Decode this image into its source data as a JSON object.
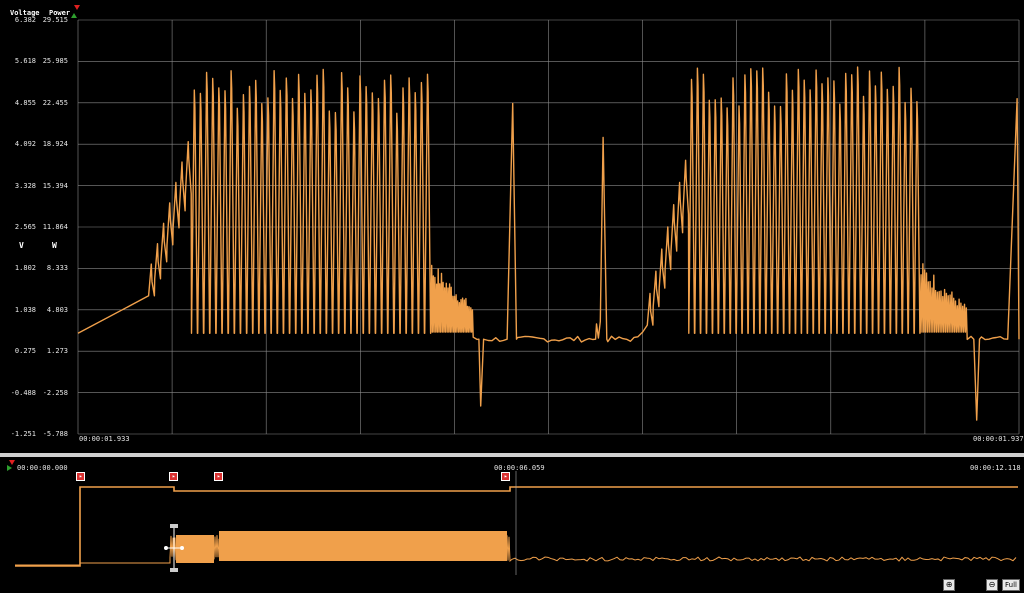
{
  "chart_data": {
    "type": "line",
    "left_axis_title": "Voltage",
    "right_axis_title": "Power",
    "left_unit": "V",
    "right_unit": "W",
    "voltage_ticks": [
      "6.382",
      "5.618",
      "4.855",
      "4.092",
      "3.328",
      "2.565",
      "1.802",
      "1.038",
      "0.275",
      "-0.488",
      "-1.251"
    ],
    "power_ticks": [
      "29.515",
      "25.985",
      "22.455",
      "18.924",
      "15.394",
      "11.864",
      "8.333",
      "4.803",
      "1.273",
      "-2.258",
      "-5.788"
    ],
    "ylim": [
      -5.788,
      29.515
    ],
    "x_start": "00:00:01.933",
    "x_end": "00:00:01.937",
    "overview_start": "00:00:00.000",
    "overview_mid": "00:00:06.059",
    "overview_end": "00:00:12.118",
    "grid": true,
    "series": [
      {
        "color": "#f0a04b",
        "bursts": [
          {
            "t_start": 0.075,
            "t_ramp_end": 0.12,
            "t_end": 0.375,
            "min": 2.8,
            "ramp_start": 7.5,
            "peak": 25.5,
            "cycles": 46
          },
          {
            "t_start": 0.605,
            "t_ramp_end": 0.645,
            "t_end": 0.895,
            "min": 2.8,
            "ramp_start": 5.0,
            "peak": 25.5,
            "cycles": 46
          }
        ],
        "tails": [
          {
            "t_start": 0.375,
            "t_end": 0.42,
            "min": 2.9,
            "max": 9.0
          },
          {
            "t_start": 0.895,
            "t_end": 0.945,
            "min": 2.9,
            "max": 9.0
          }
        ],
        "baseline": 2.3,
        "dips": [
          {
            "t": 0.428,
            "v": -3.4
          },
          {
            "t": 0.955,
            "v": -4.6
          }
        ],
        "spikes": [
          {
            "t": 0.462,
            "v": 22.4
          },
          {
            "t": 0.558,
            "v": 19.5
          },
          {
            "t": 0.998,
            "v": 22.8
          }
        ]
      }
    ]
  },
  "zoom": {
    "level": "100%",
    "full_label": "Full",
    "zoom_in_icon": "zoom-in-icon",
    "zoom_out_icon": "zoom-out-icon"
  },
  "markers": {
    "count": 4,
    "icon": "flag-icon"
  }
}
